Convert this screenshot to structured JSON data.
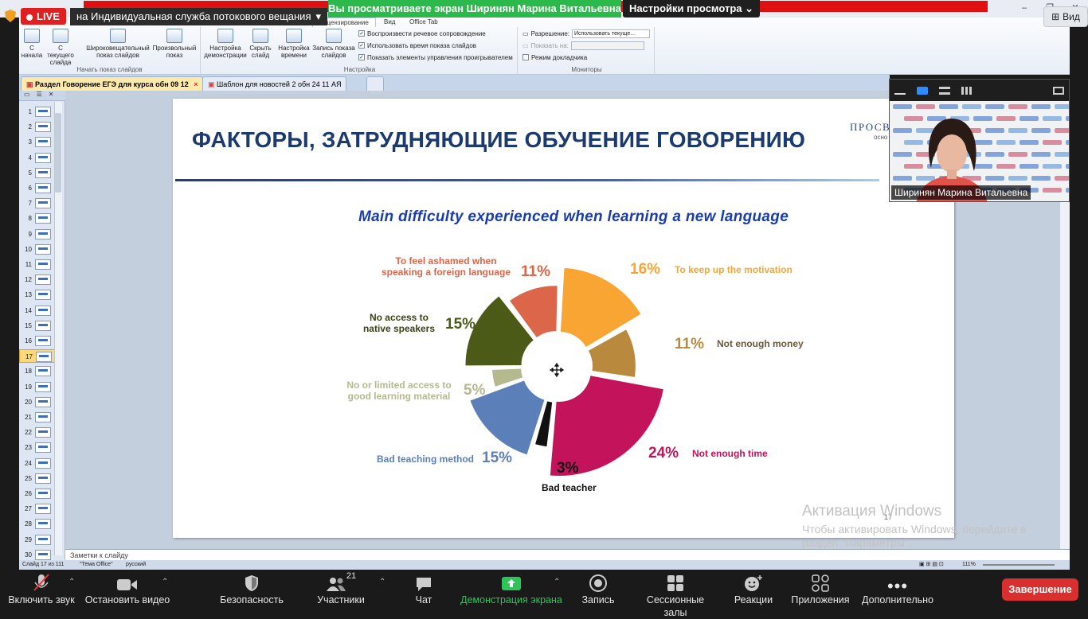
{
  "zoom_top": {
    "live_label": "LIVE",
    "stream_title": "на Индивидуальная служба потокового вещания",
    "viewing_banner": "Вы просматриваете экран Ширинян Марина Витальевна",
    "view_options": "Настройки просмотра",
    "view_button": "Вид"
  },
  "ribbon": {
    "tabs": [
      "Рецензирование",
      "Вид",
      "Office Tab"
    ],
    "buttons": [
      {
        "line1": "С",
        "line2": "начала"
      },
      {
        "line1": "С текущего",
        "line2": "слайда"
      },
      {
        "line1": "Широковещательный",
        "line2": "показ слайдов"
      },
      {
        "line1": "Произвольный",
        "line2": "показ"
      },
      {
        "line1": "Настройка",
        "line2": "демонстрации"
      },
      {
        "line1": "Скрыть",
        "line2": "слайд"
      },
      {
        "line1": "Настройка",
        "line2": "времени"
      },
      {
        "line1": "Запись показа",
        "line2": "слайдов"
      }
    ],
    "group_labels": [
      "Начать показ слайдов",
      "Настройка",
      "Мониторы"
    ],
    "checkboxes": [
      "Воспроизвести речевое сопровождение",
      "Использовать время показа слайдов",
      "Показать элементы управления проигрывателем"
    ],
    "resolution_label": "Разрешение:",
    "resolution_value": "Использовать текуще...",
    "show_on_label": "Показать на:",
    "presenter_view": "Режим докладчика"
  },
  "file_tabs": [
    {
      "label": "Раздел Говорение ЕГЭ для курса обн 09 12",
      "close": "×"
    },
    {
      "label": "Шаблон для новостей 2 обн 24 11   АЯ"
    }
  ],
  "slide_numbers": [
    "1",
    "2",
    "3",
    "4",
    "5",
    "6",
    "7",
    "8",
    "9",
    "10",
    "11",
    "12",
    "13",
    "14",
    "15",
    "16",
    "17",
    "18",
    "19",
    "20",
    "21",
    "22",
    "23",
    "24",
    "25",
    "26",
    "27",
    "28",
    "29",
    "30"
  ],
  "active_slide": "17",
  "slide": {
    "title": "ФАКТОРЫ, ЗАТРУДНЯЮЩИЕ ОБУЧЕНИЕ ГОВОРЕНИЮ",
    "logo_text": "ПРОСВ",
    "logo_sub": "осно",
    "number": "17"
  },
  "chart_data": {
    "type": "pie",
    "title": "Main difficulty experienced when learning a new language",
    "slices": [
      {
        "label": "To keep up the motivation",
        "value": 16,
        "pct": "16%",
        "color": "#f9a533"
      },
      {
        "label": "Not enough money",
        "value": 11,
        "pct": "11%",
        "color": "#b98a3e"
      },
      {
        "label": "Not enough time",
        "value": 24,
        "pct": "24%",
        "color": "#c3145b"
      },
      {
        "label": "Bad teacher",
        "value": 3,
        "pct": "3%",
        "color": "#111111"
      },
      {
        "label": "Bad teaching method",
        "value": 15,
        "pct": "15%",
        "color": "#5b7fb8"
      },
      {
        "label": "No or limited access to good learning material",
        "value": 5,
        "pct": "5%",
        "color": "#b4b98e"
      },
      {
        "label": "No access to native speakers",
        "value": 15,
        "pct": "15%",
        "color": "#4c5a17"
      },
      {
        "label": "To feel ashamed when speaking a foreign language",
        "value": 11,
        "pct": "11%",
        "color": "#dc664a"
      }
    ],
    "legend": "labels beside slices"
  },
  "pie_labels": {
    "motivation": "To keep up the motivation",
    "money": "Not enough money",
    "time": "Not enough time",
    "teacher": "Bad teacher",
    "method": "Bad teaching method",
    "material_1": "No or limited access to",
    "material_2": "good learning material",
    "native_1": "No access to",
    "native_2": "native speakers",
    "ashamed_1": "To feel ashamed when",
    "ashamed_2": "speaking a foreign language"
  },
  "notes_placeholder": "Заметки к слайду",
  "status": {
    "slide_of": "Слайд 17 из 111",
    "theme": "\"Тема Office\"",
    "lang": "русский",
    "zoom": "111%"
  },
  "activation": {
    "line1": "Активация Windows",
    "line2": "Чтобы активировать Windows, перейдите в",
    "line3": "раздел \"Параметры\"."
  },
  "camera": {
    "name": "Ширинян Марина Витальевна"
  },
  "toolbar": {
    "mute": "Включить звук",
    "video": "Остановить видео",
    "security": "Безопасность",
    "participants": "Участники",
    "participants_count": "21",
    "chat": "Чат",
    "share": "Демонстрация экрана",
    "record": "Запись",
    "breakout": "Сессионные залы",
    "reactions": "Реакции",
    "apps": "Приложения",
    "more": "Дополнительно",
    "end": "Завершение"
  }
}
